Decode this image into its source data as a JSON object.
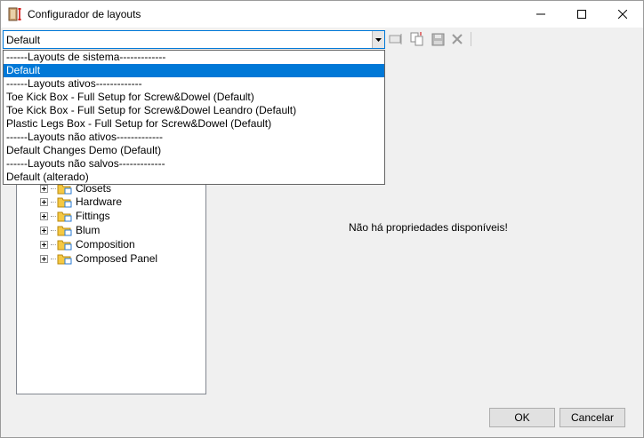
{
  "window": {
    "title": "Configurador de layouts",
    "icon": "layout-configurator-icon"
  },
  "layout_select": {
    "value": "Default",
    "options": [
      "------Layouts de sistema-------------",
      "Default",
      "------Layouts ativos-------------",
      "Toe Kick Box - Full Setup for Screw&Dowel (Default)",
      "Toe Kick Box - Full Setup for Screw&Dowel Leandro (Default)",
      "Plastic Legs Box - Full Setup for Screw&Dowel (Default)",
      "------Layouts não ativos-------------",
      "Default Changes Demo (Default)",
      "------Layouts não salvos-------------",
      "Default (alterado)"
    ],
    "selected_index": 1
  },
  "toolbar": {
    "icons": [
      "rename-icon",
      "copy-layout-icon",
      "save-icon",
      "delete-icon"
    ]
  },
  "tree": {
    "items": [
      {
        "label": "Closets"
      },
      {
        "label": "Hardware"
      },
      {
        "label": "Fittings"
      },
      {
        "label": "Blum"
      },
      {
        "label": "Composition"
      },
      {
        "label": "Composed Panel"
      }
    ]
  },
  "properties": {
    "empty_message": "Não há propriedades disponíveis!"
  },
  "buttons": {
    "ok": "OK",
    "cancel": "Cancelar"
  },
  "colors": {
    "accent": "#0078d7",
    "folder": "#f5c842"
  }
}
